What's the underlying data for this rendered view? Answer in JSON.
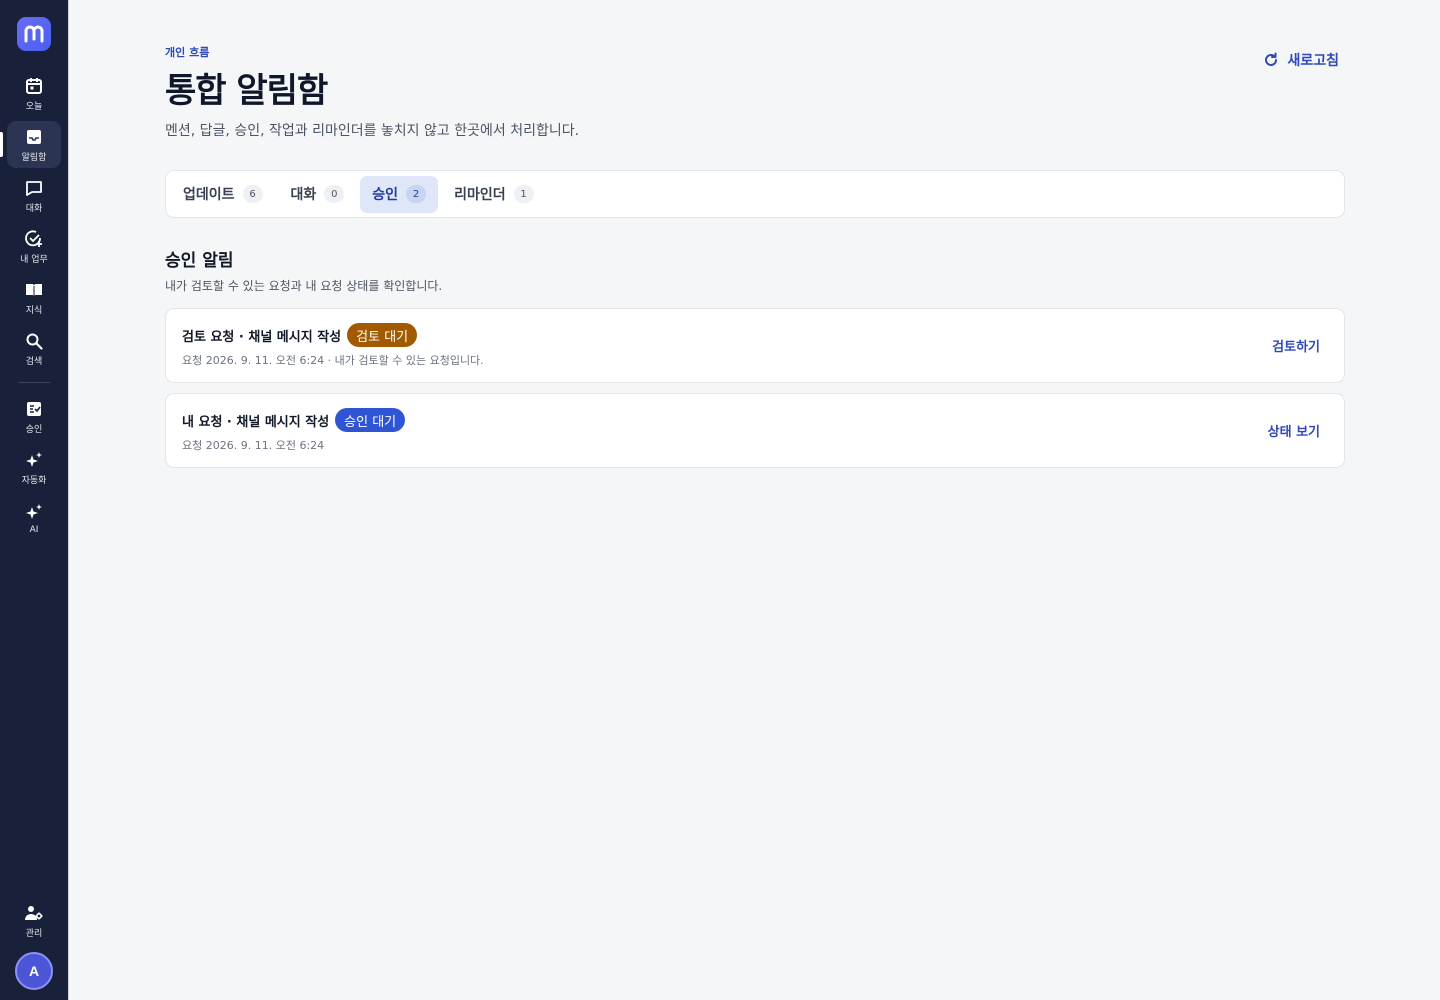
{
  "sidebar": {
    "logo_icon": "m-logo-icon",
    "items": [
      {
        "label": "오늘",
        "icon": "calendar-icon"
      },
      {
        "label": "알림함",
        "icon": "inbox-icon",
        "active": true
      },
      {
        "label": "대화",
        "icon": "chat-icon"
      },
      {
        "label": "내 업무",
        "icon": "check-circle-plus-icon"
      },
      {
        "label": "지식",
        "icon": "book-icon"
      },
      {
        "label": "검색",
        "icon": "search-icon"
      },
      {
        "label": "승인",
        "icon": "approval-icon"
      },
      {
        "label": "자동화",
        "icon": "sparkles-icon"
      },
      {
        "label": "AI",
        "icon": "sparkles-icon"
      }
    ],
    "admin_label": "관리",
    "avatar_initial": "A"
  },
  "header": {
    "eyebrow": "개인 흐름",
    "title": "통합 알림함",
    "subtitle": "멘션, 답글, 승인, 작업과 리마인더를 놓치지 않고 한곳에서 처리합니다.",
    "refresh_label": "새로고침"
  },
  "tabs": [
    {
      "label": "업데이트",
      "count": "6"
    },
    {
      "label": "대화",
      "count": "0"
    },
    {
      "label": "승인",
      "count": "2",
      "active": true
    },
    {
      "label": "리마인더",
      "count": "1"
    }
  ],
  "section": {
    "title": "승인 알림",
    "description": "내가 검토할 수 있는 요청과 내 요청 상태를 확인합니다."
  },
  "cards": [
    {
      "title": "검토 요청 · 채널 메시지 작성",
      "badge": "검토 대기",
      "badge_color": "#a25a00",
      "meta": "요청 2026. 9. 11. 오전 6:24 · 내가 검토할 수 있는 요청입니다.",
      "action": "검토하기"
    },
    {
      "title": "내 요청 · 채널 메시지 작성",
      "badge": "승인 대기",
      "badge_color": "#2f55d4",
      "meta": "요청 2026. 9. 11. 오전 6:24",
      "action": "상태 보기"
    }
  ],
  "colors": {
    "sidebar_bg": "#19203a",
    "accent": "#2f49b9",
    "page_bg": "#f5f6f8"
  }
}
